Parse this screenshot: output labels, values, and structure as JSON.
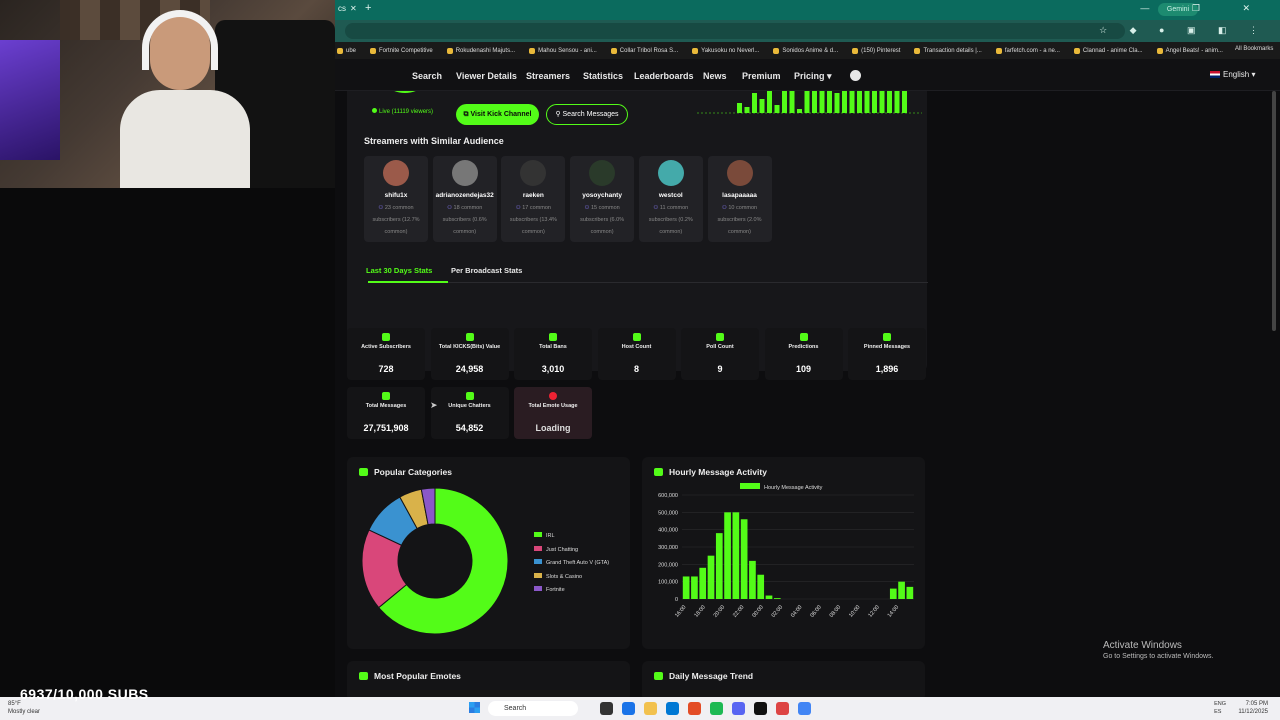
{
  "browser": {
    "tab_fragment": "cs",
    "wincontrols": "— ❐ ✕",
    "gemini_label": "Gemini",
    "bookmarks": [
      "ube",
      "Fortnite Competitive",
      "Rokudenashi Majuts...",
      "Mahou Sensou - ani...",
      "Collar Tribol Rosa S...",
      "Yakusoku no Neverl...",
      "Sonidos Anime & d...",
      "(150) Pinterest",
      "Transaction details |...",
      "farfetch.com - a ne...",
      "Clannad - anime Cla...",
      "Angel Beats! - anim..."
    ],
    "all_bookmarks": "All Bookmarks"
  },
  "nav": {
    "items": [
      "Search",
      "Viewer Details",
      "Streamers",
      "Statistics",
      "Leaderboards",
      "News",
      "Premium",
      "Pricing ▾"
    ],
    "language": "English"
  },
  "header": {
    "live_text": "Live (11119 viewers)",
    "visit_button": "Visit Kick Channel",
    "search_button": "Search Messages"
  },
  "similar": {
    "title": "Streamers with Similar Audience",
    "streamers": [
      {
        "name": "shifu1x",
        "info1": "23 common",
        "info2": "subscribers (12.7%",
        "info3": "common)"
      },
      {
        "name": "adrianozendejas32",
        "info1": "18 common",
        "info2": "subscribers (0.6%",
        "info3": "common)"
      },
      {
        "name": "raeken",
        "info1": "17 common",
        "info2": "subscribers (13.4%",
        "info3": "common)"
      },
      {
        "name": "yosoychanty",
        "info1": "15 common",
        "info2": "subscribers (6.0%",
        "info3": "common)"
      },
      {
        "name": "westcol",
        "info1": "11 common",
        "info2": "subscribers (0.2%",
        "info3": "common)"
      },
      {
        "name": "lasapaaaaa",
        "info1": "10 common",
        "info2": "subscribers (2.0%",
        "info3": "common)"
      }
    ]
  },
  "tabs": {
    "active": "Last 30 Days Stats",
    "inactive": "Per Broadcast Stats"
  },
  "stats": [
    {
      "label": "Active Subscribers",
      "value": "728"
    },
    {
      "label": "Total KICKS(Bits) Value",
      "value": "24,958"
    },
    {
      "label": "Total Bans",
      "value": "3,010"
    },
    {
      "label": "Host Count",
      "value": "8"
    },
    {
      "label": "Poll Count",
      "value": "9"
    },
    {
      "label": "Predictions",
      "value": "109"
    },
    {
      "label": "Pinned Messages",
      "value": "1,896"
    },
    {
      "label": "Total Messages",
      "value": "27,751,908"
    },
    {
      "label": "Unique Chatters",
      "value": "54,852"
    },
    {
      "label": "Total Emote Usage",
      "value": "Loading"
    }
  ],
  "charts_meta": {
    "categories_title": "Popular Categories",
    "hourly_title": "Hourly Message Activity",
    "emotes_title": "Most Popular Emotes",
    "daily_title": "Daily Message Trend"
  },
  "chart_data": [
    {
      "type": "pie",
      "title": "Popular Categories",
      "categories": [
        "IRL",
        "Just Chatting",
        "Grand Theft Auto V (GTA)",
        "Slots & Casino",
        "Fortnite"
      ],
      "values": [
        64,
        18,
        10,
        5,
        3
      ],
      "colors": [
        "#53fc18",
        "#d9477a",
        "#3a92d0",
        "#d9b24a",
        "#8b58c9"
      ],
      "legend": "right"
    },
    {
      "type": "bar",
      "title": "Hourly Message Activity",
      "series": [
        {
          "name": "Hourly Message Activity",
          "values": [
            130000,
            130000,
            180000,
            250000,
            380000,
            500000,
            500000,
            460000,
            220000,
            140000,
            20000,
            5000,
            0,
            0,
            0,
            0,
            0,
            0,
            0,
            0,
            0,
            0,
            0,
            0,
            0,
            60000,
            100000,
            70000
          ]
        }
      ],
      "xtick_labels": [
        "16:00",
        "18:00",
        "20:00",
        "22:00",
        "00:00",
        "02:00",
        "04:00",
        "06:00",
        "08:00",
        "10:00",
        "12:00",
        "14:00"
      ],
      "yticks": [
        "0",
        "100,000",
        "200,000",
        "300,000",
        "400,000",
        "500,000",
        "600,000"
      ],
      "ylim": [
        0,
        600000
      ],
      "legend": "top",
      "color": "#53fc18"
    }
  ],
  "overlay": {
    "subs": "6937/10,000 SUBS",
    "activate_title": "Activate Windows",
    "activate_sub": "Go to Settings to activate Windows."
  },
  "taskbar": {
    "weather_temp": "85°F",
    "weather_desc": "Mostly clear",
    "search": "Search",
    "lang1": "ENG",
    "lang2": "ES",
    "time": "7:05 PM",
    "date": "11/12/2025"
  }
}
